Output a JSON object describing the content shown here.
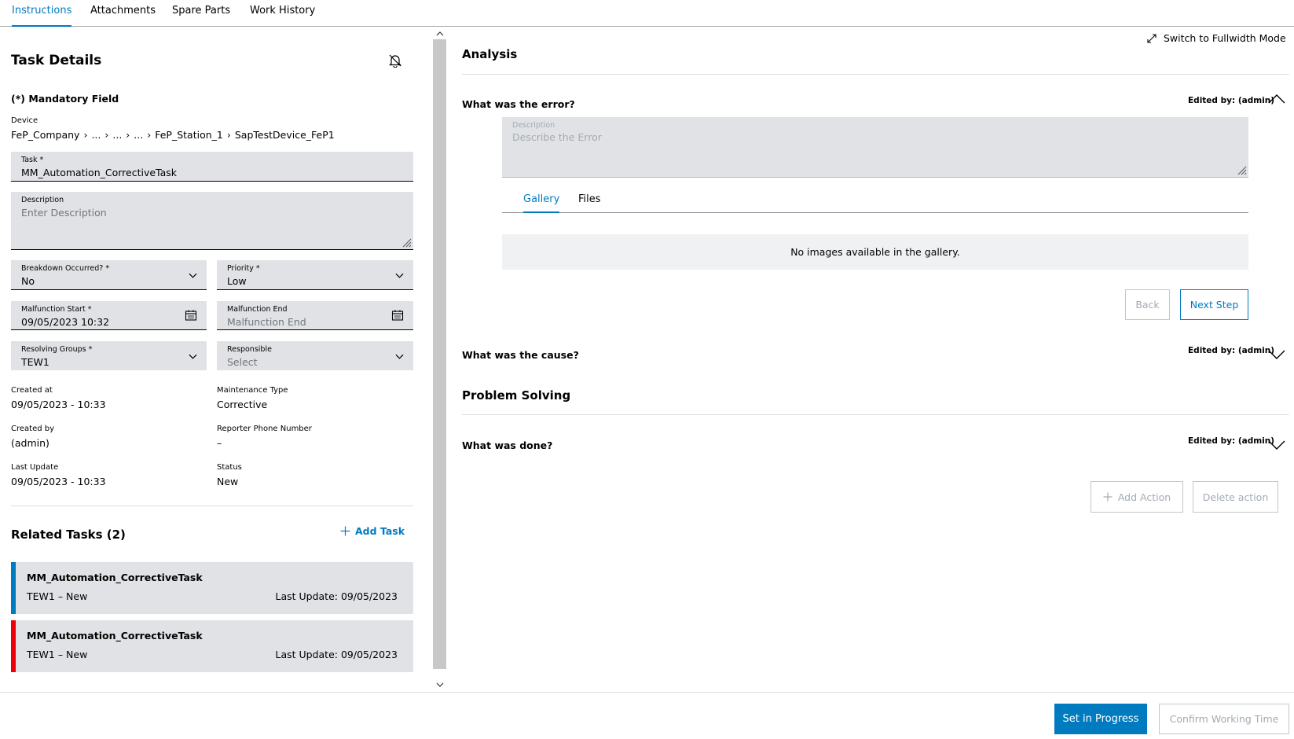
{
  "tabs": [
    {
      "label": "Instructions",
      "active": true
    },
    {
      "label": "Attachments"
    },
    {
      "label": "Spare Parts"
    },
    {
      "label": "Work History"
    }
  ],
  "task_details": {
    "title": "Task Details",
    "mandatory": "(*) Mandatory Field",
    "device_label": "Device",
    "breadcrumb": [
      "FeP_Company",
      "...",
      "...",
      "...",
      "FeP_Station_1",
      "SapTestDevice_FeP1"
    ],
    "task_label": "Task *",
    "task_value": "MM_Automation_CorrectiveTask",
    "description_label": "Description",
    "description_placeholder": "Enter Description",
    "breakdown_label": "Breakdown Occurred? *",
    "breakdown_value": "No",
    "priority_label": "Priority *",
    "priority_value": "Low",
    "malfunction_start_label": "Malfunction Start *",
    "malfunction_start_value": "09/05/2023 10:32",
    "malfunction_end_label": "Malfunction End",
    "malfunction_end_placeholder": "Malfunction End",
    "resolving_groups_label": "Resolving Groups *",
    "resolving_groups_value": "TEW1",
    "responsible_label": "Responsible",
    "responsible_placeholder": "Select",
    "created_at_label": "Created at",
    "created_at_value": "09/05/2023 - 10:33",
    "maintenance_type_label": "Maintenance Type",
    "maintenance_type_value": "Corrective",
    "created_by_label": "Created by",
    "created_by_value": "(admin)",
    "reporter_phone_label": "Reporter Phone Number",
    "reporter_phone_value": "–",
    "last_update_label": "Last Update",
    "last_update_value": "09/05/2023 - 10:33",
    "status_label": "Status",
    "status_value": "New"
  },
  "related_tasks": {
    "title": "Related Tasks (2)",
    "add_label": "Add Task",
    "items": [
      {
        "title": "MM_Automation_CorrectiveTask",
        "sub": "TEW1  –  New",
        "updated": "Last Update: 09/05/2023",
        "color": "#007bc0"
      },
      {
        "title": "MM_Automation_CorrectiveTask",
        "sub": "TEW1  –  New",
        "updated": "Last Update: 09/05/2023",
        "color": "#ed0007"
      }
    ]
  },
  "analysis": {
    "fullwidth_label": "Switch to Fullwidth Mode",
    "title": "Analysis",
    "q1": "What was the error?",
    "q1_edited": "Edited by: (admin)",
    "desc_label": "Description",
    "desc_placeholder": "Describe the Error",
    "gallery_tab": "Gallery",
    "files_tab": "Files",
    "no_images": "No images available in the gallery.",
    "back_label": "Back",
    "next_label": "Next Step",
    "q2": "What was the cause?",
    "q2_edited": "Edited by: (admin)"
  },
  "problem_solving": {
    "title": "Problem Solving",
    "q3": "What was done?",
    "q3_edited": "Edited by: (admin)",
    "add_action_label": "Add Action",
    "delete_action_label": "Delete action"
  },
  "footer": {
    "set_in_progress": "Set in Progress",
    "confirm_working_time": "Confirm Working Time"
  },
  "colors": {
    "accent": "#007bc0",
    "danger": "#ed0007",
    "field_bg": "#e0e2e5"
  }
}
